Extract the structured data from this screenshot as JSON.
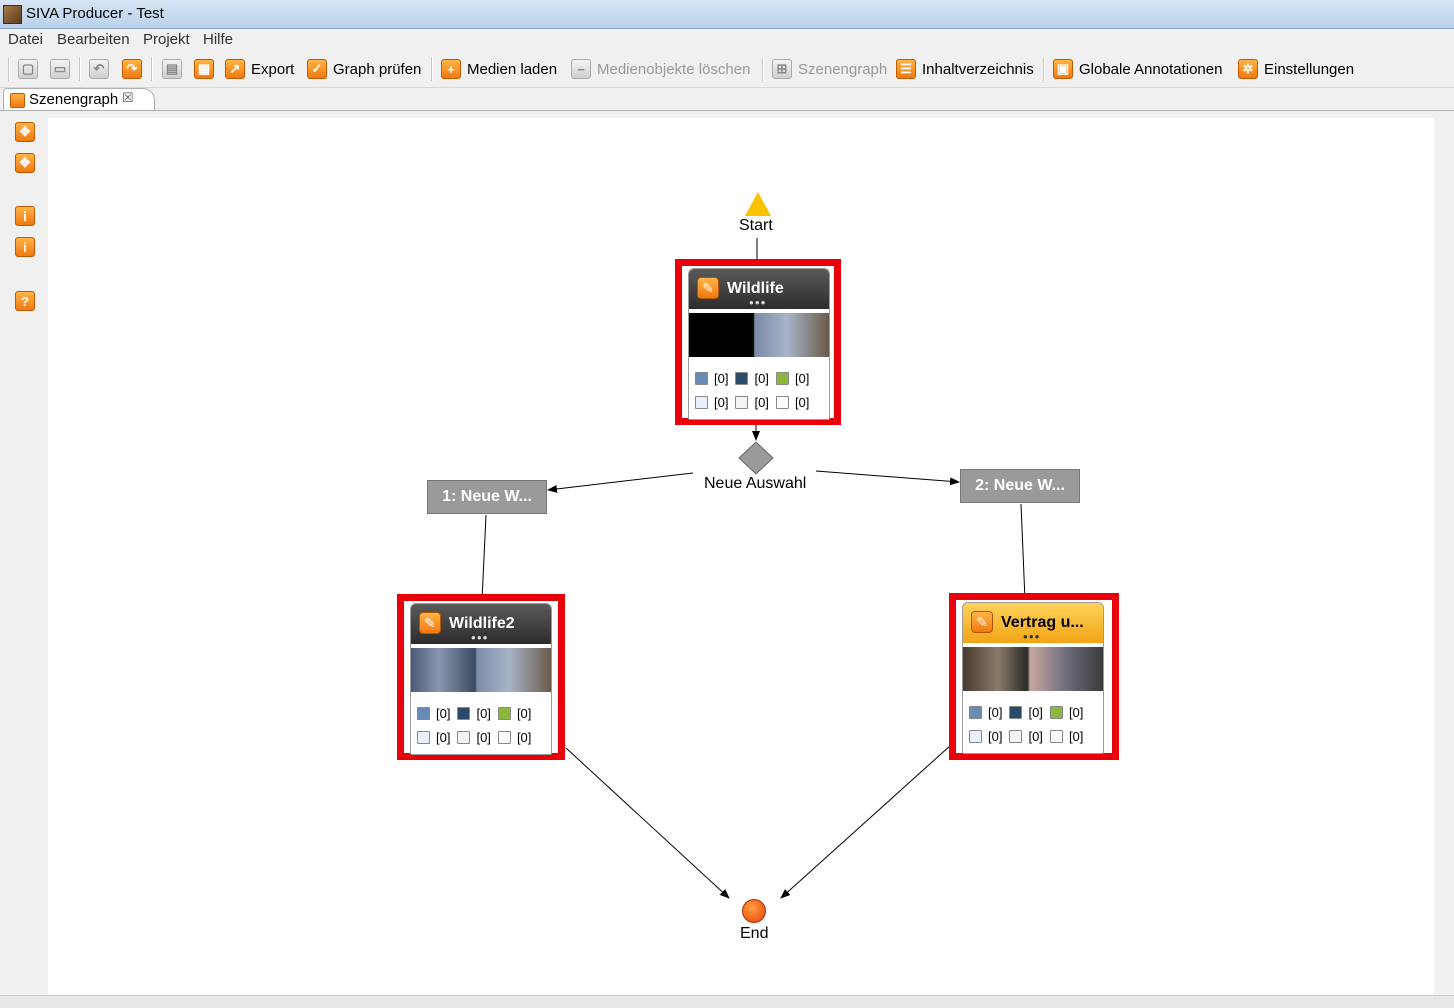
{
  "window": {
    "title": "SIVA Producer - Test"
  },
  "menu": [
    "Datei",
    "Bearbeiten",
    "Projekt",
    "Hilfe"
  ],
  "toolbar": {
    "export": "Export",
    "graph_pruefen": "Graph prüfen",
    "medien_laden": "Medien laden",
    "medienobjekte_loeschen": "Medienobjekte löschen",
    "szenengraph": "Szenengraph",
    "inhaltverzeichnis": "Inhaltverzeichnis",
    "globale_annotationen": "Globale Annotationen",
    "einstellungen": "Einstellungen"
  },
  "tab": {
    "label": "Szenengraph",
    "close": "☒"
  },
  "graph": {
    "start_label": "Start",
    "end_label": "End",
    "selection_label": "Neue Auswahl",
    "choices": [
      "1: Neue W...",
      "2: Neue W..."
    ],
    "scenes": [
      {
        "title": "Wildlife",
        "stats": [
          "[0]",
          "[0]",
          "[0]",
          "[0]",
          "[0]",
          "[0]"
        ]
      },
      {
        "title": "Wildlife2",
        "stats": [
          "[0]",
          "[0]",
          "[0]",
          "[0]",
          "[0]",
          "[0]"
        ]
      },
      {
        "title": "Vertrag u...",
        "stats": [
          "[0]",
          "[0]",
          "[0]",
          "[0]",
          "[0]",
          "[0]"
        ]
      }
    ]
  },
  "colors": {
    "selection_border": "#e8000a",
    "accent_orange": "#f07a10",
    "start": "#f8c400",
    "choice": "#9a9a9a"
  }
}
